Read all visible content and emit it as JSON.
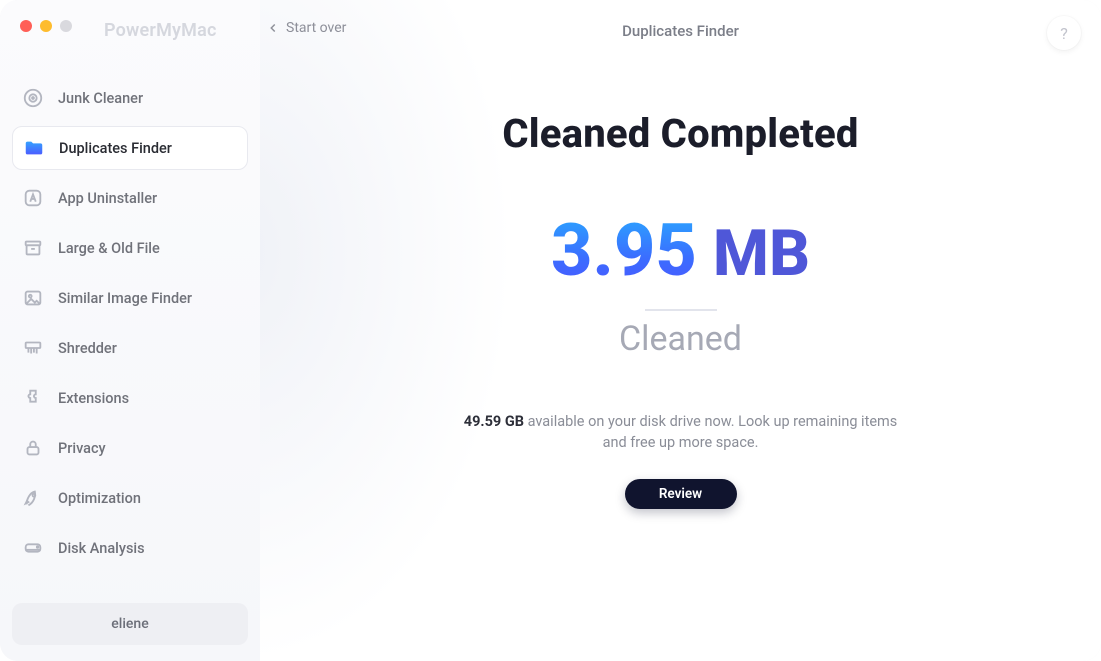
{
  "brand": "PowerMyMac",
  "topbar": {
    "back_label": "Start over",
    "title": "Duplicates Finder",
    "help_glyph": "?"
  },
  "sidebar": {
    "items": [
      {
        "label": "Junk Cleaner"
      },
      {
        "label": "Duplicates Finder"
      },
      {
        "label": "App Uninstaller"
      },
      {
        "label": "Large & Old File"
      },
      {
        "label": "Similar Image Finder"
      },
      {
        "label": "Shredder"
      },
      {
        "label": "Extensions"
      },
      {
        "label": "Privacy"
      },
      {
        "label": "Optimization"
      },
      {
        "label": "Disk Analysis"
      }
    ],
    "user": "eliene"
  },
  "result": {
    "headline": "Cleaned Completed",
    "size_value": "3.95",
    "size_unit": "MB",
    "sub_label": "Cleaned",
    "free_space": "49.59 GB",
    "description_tail": " available on your disk drive now. Look up remaining items and free up more space.",
    "review_label": "Review"
  }
}
